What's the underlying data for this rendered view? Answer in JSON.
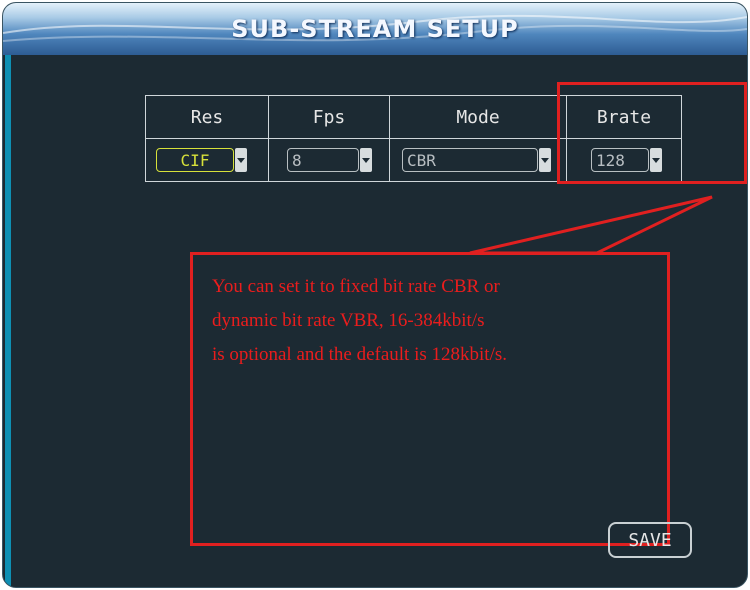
{
  "window": {
    "title": "SUB-STREAM SETUP"
  },
  "table": {
    "headers": [
      "Res",
      "Fps",
      "Mode",
      "Brate"
    ],
    "values": {
      "res": "CIF",
      "fps": "8",
      "mode": "CBR",
      "brate": "128"
    }
  },
  "callout": {
    "line1": "You can set it to fixed bit rate CBR or",
    "line2": "dynamic bit rate VBR, 16-384kbit/s",
    "line3": "is optional and the default is 128kbit/s."
  },
  "buttons": {
    "save": "SAVE"
  },
  "colors": {
    "panel_bg": "#1c2a33",
    "title_gradient_top": "#e4f1fb",
    "title_gradient_bottom": "#2d5c93",
    "annotation_red": "#e02020",
    "active_yellow": "#d7e13a",
    "accent_bar": "#0e8fb3"
  }
}
